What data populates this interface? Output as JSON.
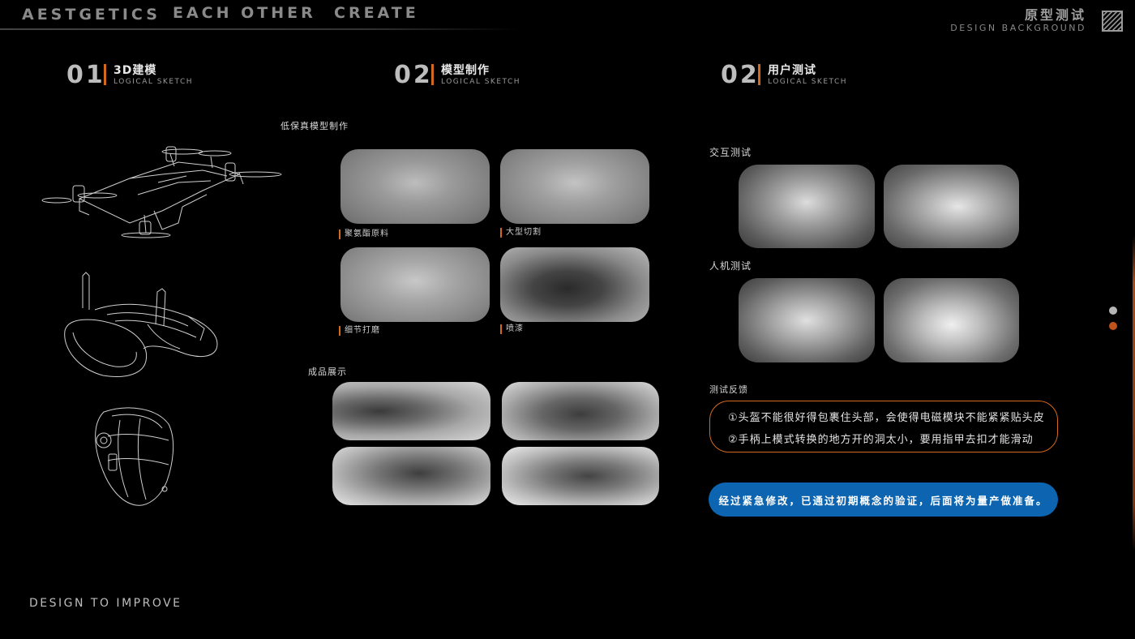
{
  "nav": {
    "items": [
      "AESTGETICS",
      "EACH OTHER",
      "CREATE"
    ]
  },
  "brand": {
    "title_cn": "原型测试",
    "subtitle_en": "DESIGN BACKGROUND",
    "logo_icon": "hatched-square-icon"
  },
  "sections": [
    {
      "num": "01",
      "title": "3D建模",
      "subtitle": "LOGICAL SKETCH"
    },
    {
      "num": "02",
      "title": "模型制作",
      "subtitle": "LOGICAL SKETCH"
    },
    {
      "num": "02",
      "title": "用户测试",
      "subtitle": "LOGICAL SKETCH"
    }
  ],
  "model": {
    "low_fidelity_label": "低保真模型制作",
    "steps": [
      "聚氨酯原料",
      "大型切割",
      "细节打磨",
      "喷漆"
    ],
    "finished_label": "成品展示"
  },
  "testing": {
    "interaction_label": "交互测试",
    "ergonomics_label": "人机测试",
    "feedback_label": "测试反馈",
    "feedback": [
      "①头盔不能很好得包裹住头部，会使得电磁模块不能紧紧贴头皮",
      "②手柄上模式转换的地方开的洞太小，要用指甲去扣才能滑动"
    ],
    "conclusion": "经过紧急修改，已通过初期概念的验证，后面将为量产做准备。"
  },
  "footer": {
    "tagline": "DESIGN TO IMPROVE"
  },
  "pager": {
    "dots": [
      {
        "state": "inactive",
        "color": "#b5b5b5"
      },
      {
        "state": "active",
        "color": "#c0521c"
      }
    ]
  },
  "colors": {
    "accent_orange": "#d2691e",
    "pill_blue": "#0d64b0",
    "background": "#000000"
  }
}
